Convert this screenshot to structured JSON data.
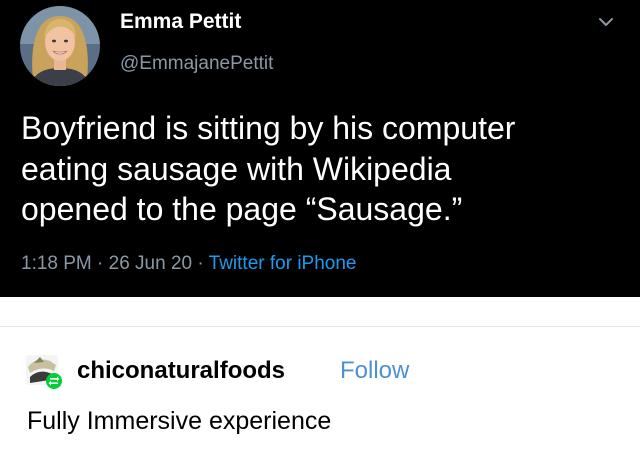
{
  "tweet": {
    "author_name": "Emma Pettit",
    "handle": "@EmmajanePettit",
    "text_lines": [
      "Boyfriend is sitting by his computer",
      "eating sausage with Wikipedia",
      "opened to the page “Sausage.”"
    ],
    "time_date": "1:18 PM · 26 Jun 20 · ",
    "source": "Twitter for iPhone",
    "avatar_icon": "profile-photo",
    "menu_icon": "chevron-down-icon"
  },
  "reblog": {
    "blog_name": "chiconaturalfoods",
    "follow_label": "Follow",
    "caption": "Fully Immersive experience",
    "avatar_icon": "blog-avatar-with-reblog-badge",
    "badge_icon": "reblog-icon"
  },
  "colors": {
    "tweet_background": "#000000",
    "tweet_secondary_text": "#8b98a5",
    "tweet_link": "#1d9bf0",
    "follow_link": "#4f8fd6",
    "reblog_badge": "#01cf35"
  }
}
